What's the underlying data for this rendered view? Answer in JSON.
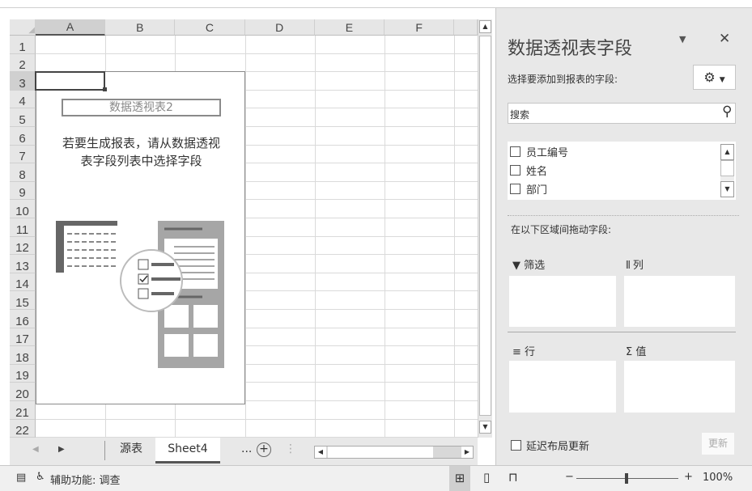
{
  "sheet": {
    "columns": [
      "A",
      "B",
      "C",
      "D",
      "E",
      "F"
    ],
    "rows": [
      "1",
      "2",
      "3",
      "4",
      "5",
      "6",
      "7",
      "8",
      "9",
      "10",
      "11",
      "12",
      "13",
      "14",
      "15",
      "16",
      "17",
      "18",
      "19",
      "20",
      "21",
      "22"
    ],
    "selected_cell": "A3",
    "pivot_placeholder": {
      "name": "数据透视表2",
      "line1": "若要生成报表，请从数据透视",
      "line2": "表字段列表中选择字段"
    }
  },
  "tabs": {
    "items": [
      {
        "label": "源表",
        "active": false
      },
      {
        "label": "Sheet4",
        "active": true
      }
    ],
    "more": "...",
    "add": "+"
  },
  "status": {
    "accessibility": "辅助功能: 调查",
    "zoom": "100%",
    "zoom_minus": "−",
    "zoom_plus": "+",
    "zoom_percent": 100
  },
  "pane": {
    "title": "数据透视表字段",
    "choose_label": "选择要添加到报表的字段:",
    "search_placeholder": "搜索",
    "fields": [
      {
        "label": "员工编号",
        "checked": false
      },
      {
        "label": "姓名",
        "checked": false
      },
      {
        "label": "部门",
        "checked": false
      }
    ],
    "drag_label": "在以下区域间拖动字段:",
    "areas": {
      "filter": "筛选",
      "columns": "列",
      "rows": "行",
      "values": "值"
    },
    "defer_label": "延迟布局更新",
    "update_button": "更新"
  }
}
